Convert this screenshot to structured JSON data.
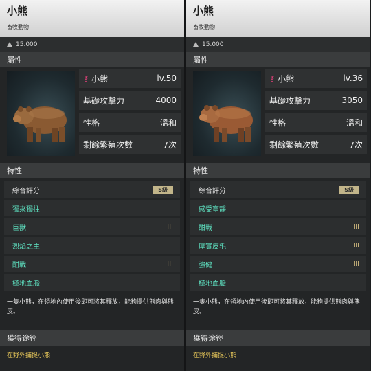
{
  "panels": [
    {
      "title": "小熊",
      "subtitle": "畜牧動物",
      "price": "15.000",
      "attr_title": "屬性",
      "stats": [
        {
          "key": "小熊",
          "value": "lv.50"
        },
        {
          "key": "基礎攻擊力",
          "value": "4000"
        },
        {
          "key": "性格",
          "value": "溫和"
        },
        {
          "key": "剩餘繁殖次數",
          "value": "7次"
        }
      ],
      "traits_title": "特性",
      "overall_label": "綜合評分",
      "overall_badge": "S級",
      "traits": [
        {
          "name": "獨來獨往",
          "rank": ""
        },
        {
          "name": "巨獸",
          "rank": "III"
        },
        {
          "name": "烈焰之主",
          "rank": ""
        },
        {
          "name": "酣戰",
          "rank": "III"
        },
        {
          "name": "極地血脈",
          "rank": ""
        }
      ],
      "description": "一隻小熊，在領地內使用後即可將其釋放，能夠提供熊肉與熊皮。",
      "obtain_title": "獲得途徑",
      "obtain_text": "在野外捕捉小熊"
    },
    {
      "title": "小熊",
      "subtitle": "畜牧動物",
      "price": "15.000",
      "attr_title": "屬性",
      "stats": [
        {
          "key": "小熊",
          "value": "lv.36"
        },
        {
          "key": "基礎攻擊力",
          "value": "3050"
        },
        {
          "key": "性格",
          "value": "溫和"
        },
        {
          "key": "剩餘繁殖次數",
          "value": "7次"
        }
      ],
      "traits_title": "特性",
      "overall_label": "綜合評分",
      "overall_badge": "S級",
      "traits": [
        {
          "name": "感受寧靜",
          "rank": ""
        },
        {
          "name": "酣戰",
          "rank": "III"
        },
        {
          "name": "厚實皮毛",
          "rank": "III"
        },
        {
          "name": "強健",
          "rank": "III"
        },
        {
          "name": "極地血脈",
          "rank": ""
        }
      ],
      "description": "一隻小熊，在領地內使用後即可將其釋放，能夠提供熊肉與熊皮。",
      "obtain_title": "獲得途徑",
      "obtain_text": "在野外捕捉小熊"
    }
  ],
  "colors": {
    "trait_text": "#5ee0c0",
    "rank_text": "#c7b27a",
    "badge_bg": "#c2b58a",
    "obtain_text": "#e8c85a",
    "pet_icon": "#e2407a"
  }
}
